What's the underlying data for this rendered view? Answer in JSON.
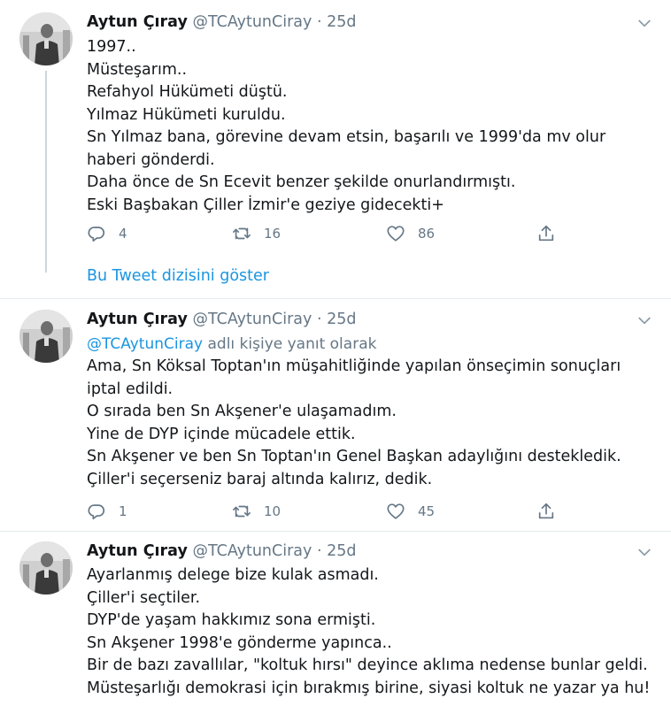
{
  "tweets": [
    {
      "author_name": "Aytun Çıray",
      "author_handle": "@TCAytunCiray",
      "separator": "·",
      "time": "25d",
      "lines": [
        "1997..",
        "Müsteşarım..",
        "Refahyol Hükümeti düştü.",
        "Yılmaz Hükümeti kuruldu.",
        "Sn Yılmaz bana, görevine devam etsin, başarılı ve 1999'da mv olur haberi gönderdi.",
        "Daha önce de Sn Ecevit benzer şekilde onurlandırmıştı.",
        "Eski Başbakan Çiller İzmir'e geziye gidecekti+"
      ],
      "replies": "4",
      "retweets": "16",
      "likes": "86",
      "show_thread": "Bu Tweet dizisini göster"
    },
    {
      "author_name": "Aytun Çıray",
      "author_handle": "@TCAytunCiray",
      "separator": "·",
      "time": "25d",
      "reply_to_mention": "@TCAytunCiray",
      "reply_to_suffix": "adlı kişiye yanıt olarak",
      "lines": [
        "Ama, Sn Köksal Toptan'ın müşahitliğinde yapılan önseçimin sonuçları iptal edildi.",
        "O sırada ben Sn Akşener'e ulaşamadım.",
        "Yine de DYP içinde mücadele ettik.",
        "Sn Akşener ve ben Sn Toptan'ın Genel Başkan adaylığını destekledik.",
        "Çiller'i seçerseniz baraj altında kalırız, dedik."
      ],
      "replies": "1",
      "retweets": "10",
      "likes": "45"
    },
    {
      "author_name": "Aytun Çıray",
      "author_handle": "@TCAytunCiray",
      "separator": "·",
      "time": "25d",
      "lines": [
        "Ayarlanmış delege bize kulak asmadı.",
        "Çiller'i seçtiler.",
        "DYP'de yaşam hakkımız sona ermişti.",
        "Sn Akşener 1998'e gönderme yapınca..",
        "Bir de bazı zavallılar, \"koltuk hırsı\" deyince aklıma nedense bunlar geldi.",
        "Müsteşarlığı demokrasi için bırakmış birine, siyasi koltuk ne yazar ya hu!"
      ]
    }
  ],
  "icons": {
    "reply": "reply-icon",
    "retweet": "retweet-icon",
    "like": "heart-icon",
    "share": "share-icon",
    "menu": "chevron-down-icon"
  },
  "colors": {
    "link": "#1b95e0",
    "secondary_text": "#657786",
    "primary_text": "#14171a",
    "divider": "#e6ecf0",
    "thread_line": "#ccd6dd"
  }
}
